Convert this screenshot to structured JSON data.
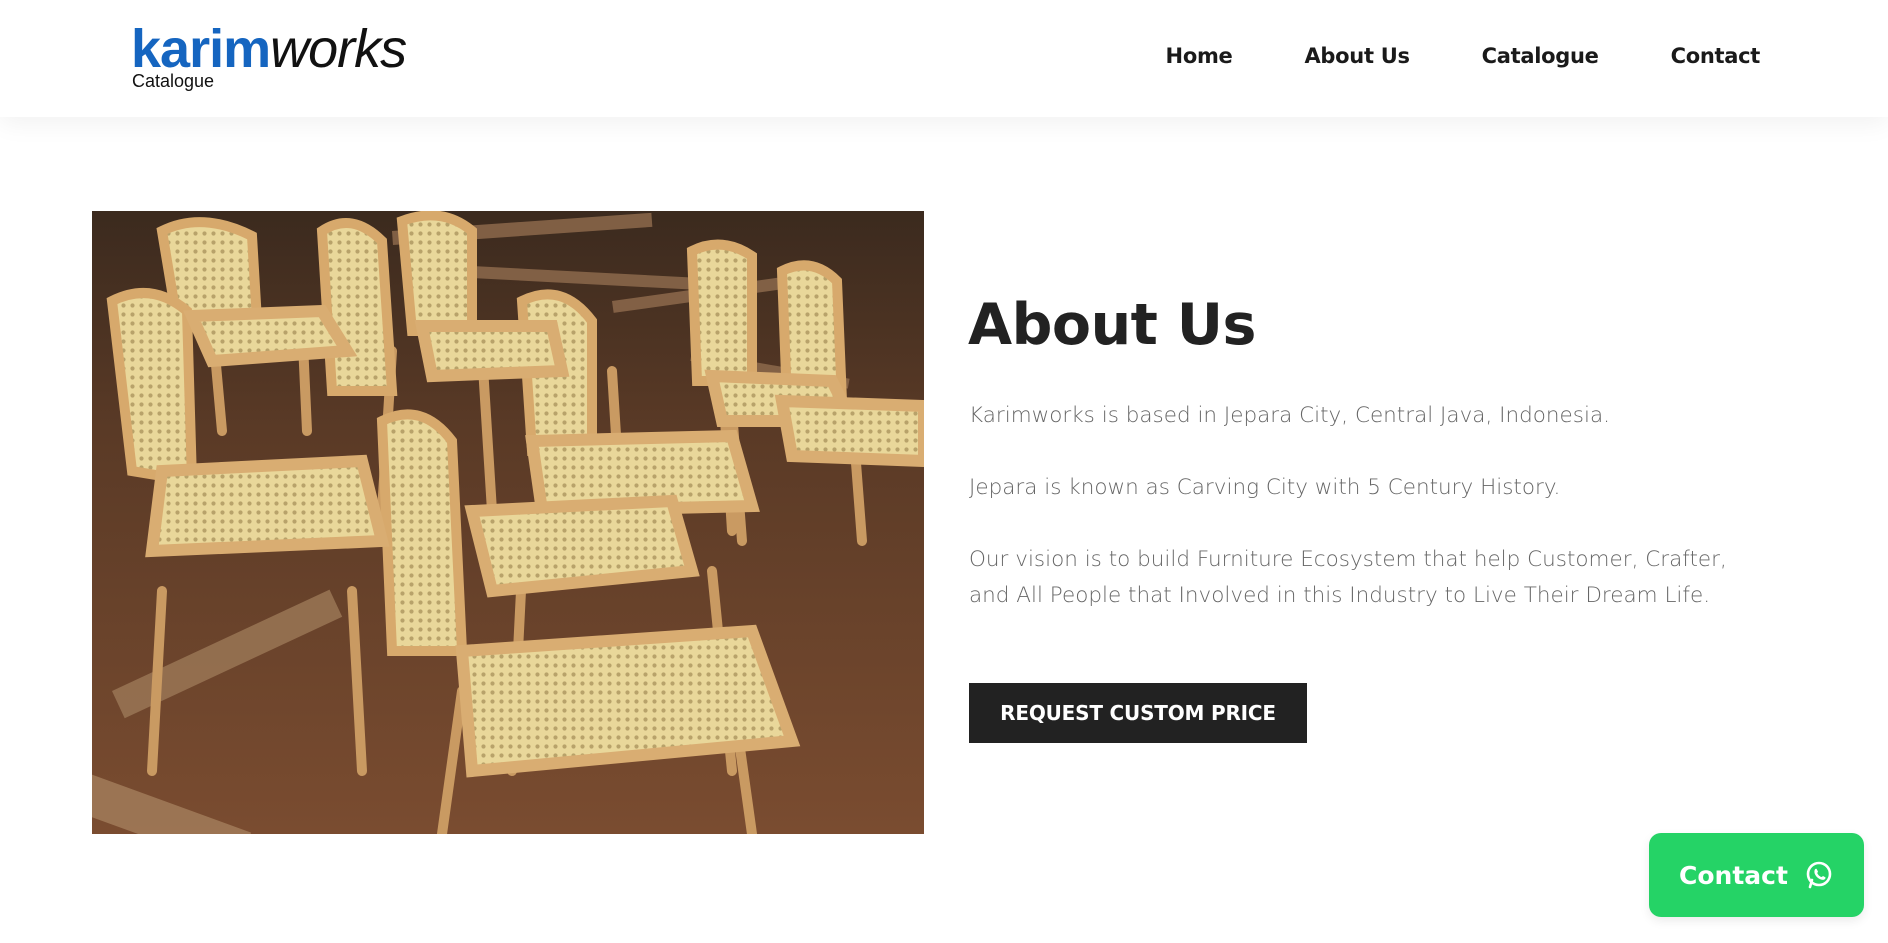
{
  "header": {
    "logo": {
      "primary": "karim",
      "secondary": "works",
      "subtitle": "Catalogue"
    },
    "nav": [
      {
        "label": "Home"
      },
      {
        "label": "About Us"
      },
      {
        "label": "Catalogue"
      },
      {
        "label": "Contact"
      }
    ]
  },
  "about": {
    "title": "About Us",
    "paragraphs": [
      "Karimworks is based in Jepara City, Central Java, Indonesia.",
      "Jepara is known as Carving City with 5 Century History.",
      "Our vision is to build Furniture Ecosystem that help Customer, Crafter, and All People that Involved in this Industry to Live Their Dream Life."
    ],
    "cta_label": "REQUEST CUSTOM PRICE"
  },
  "floating_contact": {
    "label": "Contact",
    "icon": "whatsapp-icon"
  },
  "colors": {
    "brand_blue": "#1565c0",
    "button_dark": "#222222",
    "whatsapp_green": "#25d366",
    "text_gray": "#666666"
  }
}
